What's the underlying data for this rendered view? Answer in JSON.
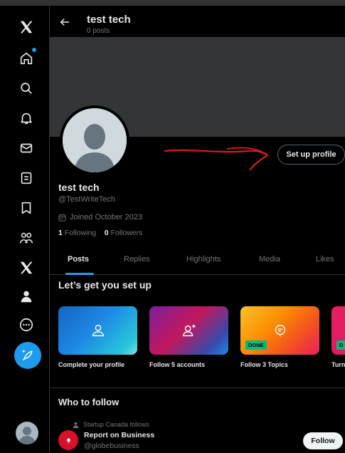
{
  "header": {
    "name": "test tech",
    "posts_count": "0 posts"
  },
  "profile": {
    "name": "test tech",
    "handle": "@TestWriteTech",
    "joined": "Joined October 2023",
    "following_count": "1",
    "following_label": "Following",
    "followers_count": "0",
    "followers_label": "Followers",
    "setup_button": "Set up profile"
  },
  "tabs": [
    "Posts",
    "Replies",
    "Highlights",
    "Media",
    "Likes"
  ],
  "setup": {
    "title": "Let’s get you set up",
    "cards": [
      {
        "label": "Complete your profile",
        "icon": "person-icon",
        "done": ""
      },
      {
        "label": "Follow 5 accounts",
        "icon": "add-person-icon",
        "done": ""
      },
      {
        "label": "Follow 3 Topics",
        "icon": "topic-icon",
        "done": "DONE"
      },
      {
        "label": "Turn",
        "icon": "notification-icon",
        "done": "D"
      }
    ]
  },
  "who_to_follow": {
    "title": "Who to follow",
    "context": "Startup Canada follows",
    "name": "Report on Business",
    "handle": "@globebusiness",
    "follow_button": "Follow"
  },
  "colors": {
    "accent": "#1d9bf0",
    "background": "#000000",
    "done_badge": "#00ba7c",
    "annotation": "#d01c1c"
  }
}
